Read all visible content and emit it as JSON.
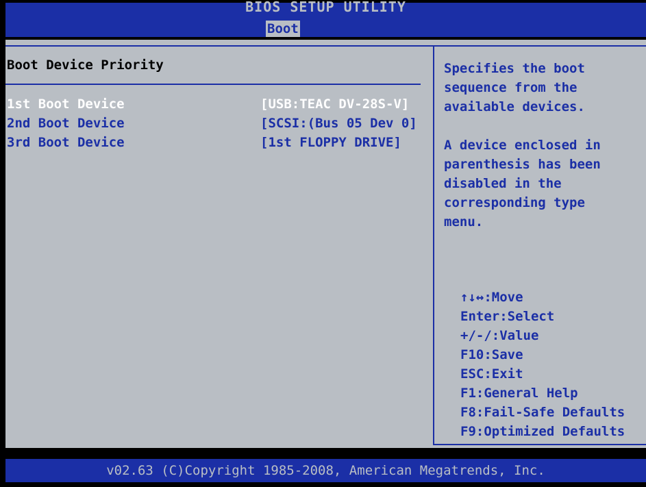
{
  "header": {
    "title": "BIOS SETUP UTILITY",
    "active_tab": "Boot"
  },
  "section": {
    "title": "Boot Device Priority"
  },
  "boot_devices": [
    {
      "label": "1st Boot Device",
      "value": "[USB:TEAC DV-28S-V]",
      "selected": true
    },
    {
      "label": "2nd Boot Device",
      "value": "[SCSI:(Bus 05 Dev 0]",
      "selected": false
    },
    {
      "label": "3rd Boot Device",
      "value": "[1st FLOPPY DRIVE]",
      "selected": false
    }
  ],
  "help": {
    "lines": [
      "Specifies the boot",
      "sequence from the",
      "available devices.",
      "",
      "A device enclosed in",
      "parenthesis has been",
      "disabled in the",
      "corresponding type",
      "menu."
    ]
  },
  "keys": [
    "↑↓↔:Move",
    "Enter:Select",
    "+/-/:Value",
    "F10:Save",
    "ESC:Exit",
    "F1:General Help",
    "F8:Fail-Safe Defaults",
    "F9:Optimized Defaults"
  ],
  "footer": {
    "text": "v02.63 (C)Copyright 1985-2008, American Megatrends, Inc."
  },
  "colors": {
    "bios_blue": "#1b2fa6",
    "bios_gray": "#b9bec4",
    "selected_text": "#ffffff",
    "background": "#000000"
  }
}
